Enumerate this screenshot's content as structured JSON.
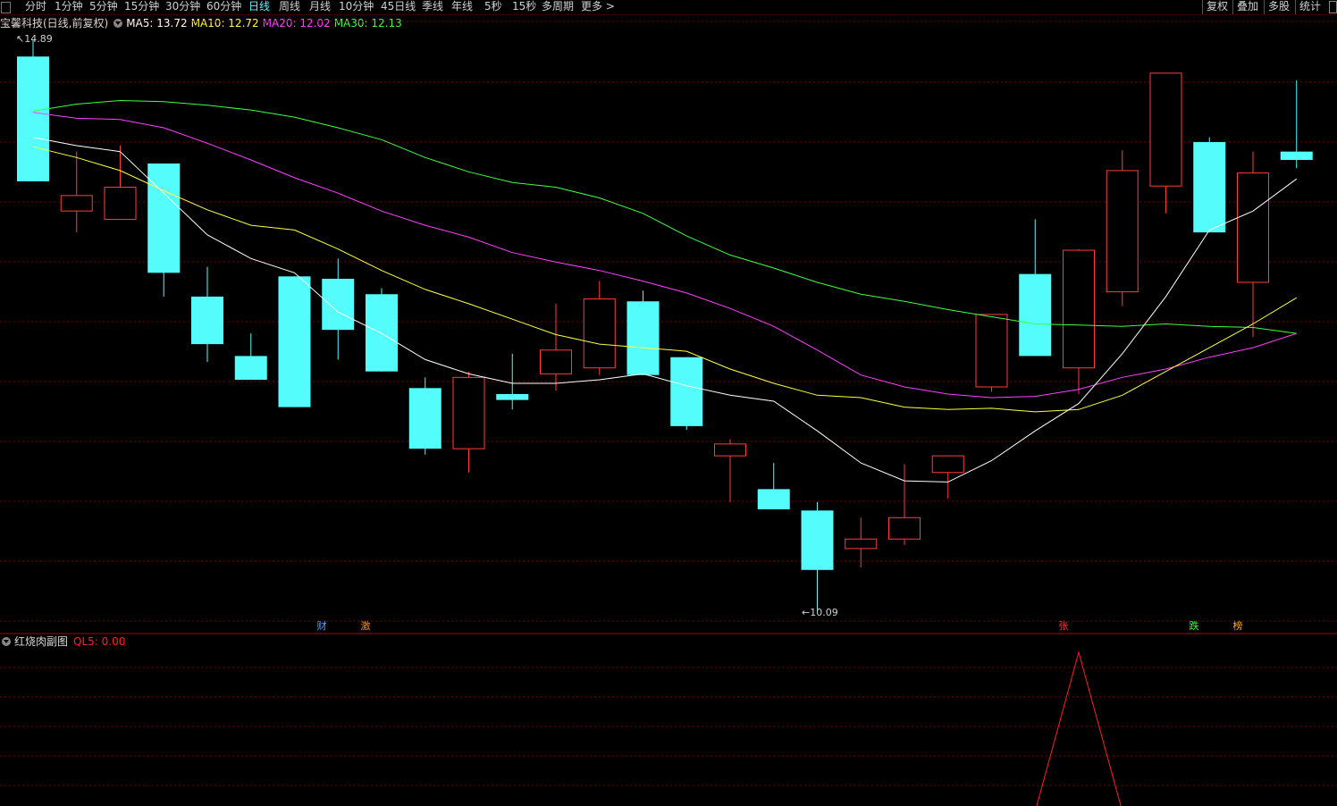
{
  "toolbar": {
    "periods": [
      "分时",
      "1分钟",
      "5分钟",
      "15分钟",
      "30分钟",
      "60分钟",
      "日线",
      "周线",
      "月线",
      "10分钟",
      "45日线",
      "季线",
      "年线",
      "5秒",
      "15秒",
      "多周期",
      "更多 >"
    ],
    "active_period": "日线",
    "right_buttons": [
      "复权",
      "叠加",
      "多股",
      "统计"
    ]
  },
  "stock": {
    "title": "宝馨科技(日线,前复权)",
    "ma5_label": "MA5: 13.72",
    "ma10_label": "MA10: 12.72",
    "ma20_label": "MA20: 12.02",
    "ma30_label": "MA30: 12.13"
  },
  "colors": {
    "up": "#ff3c3c",
    "down": "#54fcfc",
    "ma5": "#ffffff",
    "ma10": "#ffff40",
    "ma20": "#ff40ff",
    "ma30": "#40ff40",
    "grid": "#7a0000",
    "ql5": "#ff2020"
  },
  "price_labels": {
    "high": "14.89",
    "low": "10.09"
  },
  "event_tags": [
    {
      "text": "财",
      "color": "#4da6ff"
    },
    {
      "text": "激",
      "color": "#ff8800"
    },
    {
      "text": "张",
      "color": "#ff3c3c"
    },
    {
      "text": "跌",
      "color": "#40ff40"
    },
    {
      "text": "榜",
      "color": "#ffaa00"
    }
  ],
  "sub_chart": {
    "title": "红烧肉副图",
    "ql5_label": "QL5: 0.00"
  },
  "chart_data": {
    "type": "candlestick",
    "ylim": [
      10.0,
      15.0
    ],
    "candles": [
      {
        "o": 14.75,
        "h": 14.89,
        "l": 13.7,
        "c": 13.7
      },
      {
        "o": 13.45,
        "h": 13.95,
        "l": 13.27,
        "c": 13.58
      },
      {
        "o": 13.38,
        "h": 14.0,
        "l": 13.38,
        "c": 13.65
      },
      {
        "o": 13.85,
        "h": 13.85,
        "l": 12.73,
        "c": 12.93
      },
      {
        "o": 12.73,
        "h": 12.98,
        "l": 12.18,
        "c": 12.33
      },
      {
        "o": 12.23,
        "h": 12.42,
        "l": 12.03,
        "c": 12.03
      },
      {
        "o": 12.9,
        "h": 12.9,
        "l": 11.8,
        "c": 11.8
      },
      {
        "o": 12.88,
        "h": 13.05,
        "l": 12.2,
        "c": 12.45
      },
      {
        "o": 12.75,
        "h": 12.8,
        "l": 12.1,
        "c": 12.1
      },
      {
        "o": 11.96,
        "h": 12.05,
        "l": 11.4,
        "c": 11.45
      },
      {
        "o": 11.45,
        "h": 12.1,
        "l": 11.25,
        "c": 12.05
      },
      {
        "o": 11.91,
        "h": 12.25,
        "l": 11.78,
        "c": 11.86
      },
      {
        "o": 12.08,
        "h": 12.67,
        "l": 11.94,
        "c": 12.28
      },
      {
        "o": 12.13,
        "h": 12.86,
        "l": 12.07,
        "c": 12.71
      },
      {
        "o": 12.69,
        "h": 12.78,
        "l": 12.07,
        "c": 12.07
      },
      {
        "o": 12.22,
        "h": 12.22,
        "l": 11.61,
        "c": 11.64
      },
      {
        "o": 11.39,
        "h": 11.53,
        "l": 11.0,
        "c": 11.49
      },
      {
        "o": 11.11,
        "h": 11.33,
        "l": 10.96,
        "c": 10.94
      },
      {
        "o": 10.93,
        "h": 11.0,
        "l": 10.09,
        "c": 10.43
      },
      {
        "o": 10.61,
        "h": 10.87,
        "l": 10.45,
        "c": 10.69
      },
      {
        "o": 10.69,
        "h": 11.32,
        "l": 10.64,
        "c": 10.87
      },
      {
        "o": 11.25,
        "h": 11.32,
        "l": 11.03,
        "c": 11.39
      },
      {
        "o": 11.97,
        "h": 12.32,
        "l": 11.93,
        "c": 12.58
      },
      {
        "o": 12.92,
        "h": 13.38,
        "l": 12.23,
        "c": 12.23
      },
      {
        "o": 12.13,
        "h": 13.13,
        "l": 11.91,
        "c": 13.12
      },
      {
        "o": 12.77,
        "h": 13.96,
        "l": 12.65,
        "c": 13.79
      },
      {
        "o": 13.66,
        "h": 14.31,
        "l": 13.43,
        "c": 14.61
      },
      {
        "o": 14.03,
        "h": 14.07,
        "l": 13.27,
        "c": 13.27
      },
      {
        "o": 12.85,
        "h": 13.95,
        "l": 12.39,
        "c": 13.77
      },
      {
        "o": 13.95,
        "h": 14.55,
        "l": 13.81,
        "c": 13.88
      }
    ],
    "ma5": [
      14.07,
      14.0,
      13.95,
      13.6,
      13.25,
      13.05,
      12.93,
      12.6,
      12.42,
      12.2,
      12.08,
      12.0,
      12.0,
      12.03,
      12.08,
      11.98,
      11.9,
      11.85,
      11.6,
      11.33,
      11.18,
      11.17,
      11.35,
      11.6,
      11.83,
      12.25,
      12.73,
      13.29,
      13.45,
      13.72
    ],
    "ma10": [
      13.99,
      13.9,
      13.79,
      13.62,
      13.46,
      13.33,
      13.29,
      13.13,
      12.95,
      12.79,
      12.67,
      12.54,
      12.41,
      12.33,
      12.3,
      12.27,
      12.12,
      12.0,
      11.9,
      11.88,
      11.8,
      11.78,
      11.79,
      11.76,
      11.78,
      11.9,
      12.1,
      12.3,
      12.5,
      12.72
    ],
    "ma20": [
      14.28,
      14.23,
      14.22,
      14.15,
      14.02,
      13.88,
      13.73,
      13.6,
      13.45,
      13.33,
      13.23,
      13.1,
      13.02,
      12.95,
      12.86,
      12.76,
      12.63,
      12.48,
      12.28,
      12.07,
      11.97,
      11.91,
      11.88,
      11.89,
      11.95,
      12.05,
      12.12,
      12.22,
      12.3,
      12.42
    ],
    "ma30": [
      14.29,
      14.35,
      14.38,
      14.37,
      14.34,
      14.3,
      14.24,
      14.15,
      14.05,
      13.9,
      13.78,
      13.69,
      13.65,
      13.56,
      13.43,
      13.24,
      13.08,
      12.97,
      12.85,
      12.75,
      12.69,
      12.62,
      12.56,
      12.5,
      12.49,
      12.48,
      12.5,
      12.48,
      12.47,
      12.42
    ],
    "ql5": [
      0,
      0,
      0,
      0,
      0,
      0,
      0,
      0,
      0,
      0,
      0,
      0,
      0,
      0,
      0,
      0,
      0,
      0,
      0,
      0,
      0,
      0,
      0,
      0,
      1,
      0,
      0,
      0,
      0,
      0
    ]
  }
}
